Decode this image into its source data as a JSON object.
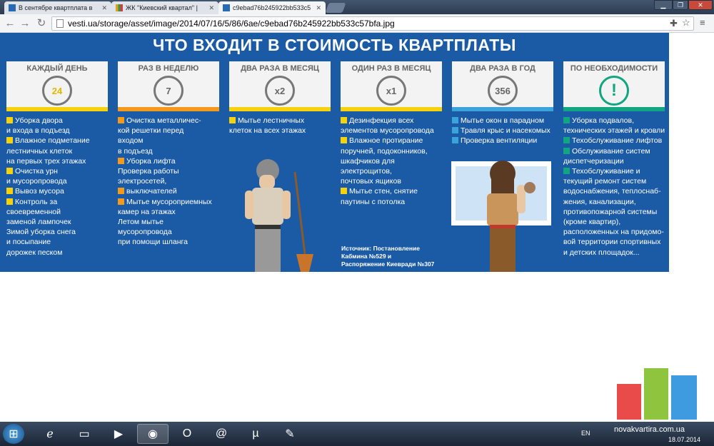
{
  "browser": {
    "tabs": [
      {
        "title": "В сентябре квартплата в",
        "icon": "vesti-favicon",
        "color": "#2a6ab3"
      },
      {
        "title": "ЖК \"Киевский квартал\" |",
        "icon": "chart-favicon",
        "color": "#e0a020"
      },
      {
        "title": "c9ebad76b245922bb533c5",
        "icon": "vesti-favicon",
        "color": "#2a6ab3"
      }
    ],
    "url": "vesti.ua/storage/asset/image/2014/07/16/5/86/6ae/c9ebad76b245922bb533c57bfa.jpg"
  },
  "infographic": {
    "title": "ЧТО ВХОДИТ В СТОИМОСТЬ КВАРТПЛАТЫ",
    "columns": [
      {
        "header": "КАЖДЫЙ ДЕНЬ",
        "icon_text": "24",
        "color": "#f5d20c",
        "items": [
          "Уборка двора",
          "и входа в подъезд",
          "Влажное подметание",
          "лестничных клеток",
          "на первых трех этажах",
          "Очистка урн",
          "и мусоропровода",
          "Вывоз мусора",
          "Контроль за",
          "своевременной",
          "заменой лампочек",
          "Зимой уборка снега",
          "и посыпание",
          "дорожек песком"
        ]
      },
      {
        "header": "РАЗ В НЕДЕЛЮ",
        "icon_text": "7",
        "color": "#f39a1c",
        "items": [
          "Очистка металличес-",
          "кой решетки перед",
          "входом",
          "в подъезд",
          "Уборка лифта",
          "Проверка работы",
          "электросетей,",
          "выключателей",
          "Мытье мусороприемных",
          "камер на этажах",
          "Летом мытье",
          "мусоропровода",
          "при помощи шланга"
        ]
      },
      {
        "header": "ДВА РАЗА В МЕСЯЦ",
        "icon_text": "x2",
        "color": "#f5d20c",
        "items": [
          "Мытье лестничных",
          "клеток на всех этажах"
        ]
      },
      {
        "header": "ОДИН РАЗ В МЕСЯЦ",
        "icon_text": "x1",
        "color": "#f5d20c",
        "items": [
          "Дезинфекция всех",
          "элементов мусоропровода",
          "Влажное протирание",
          "поручней, подоконников,",
          "шкафчиков для",
          "электрощитов,",
          "почтовых ящиков",
          "Мытье стен, снятие",
          "паутины с потолка"
        ]
      },
      {
        "header": "ДВА РАЗА В ГОД",
        "icon_text": "356",
        "color": "#3aa3dc",
        "items": [
          "Мытье окон в парадном",
          "Травля крыс и насекомых",
          "Проверка вентиляции"
        ]
      },
      {
        "header": "ПО НЕОБХОДИМОСТИ",
        "icon_text": "!",
        "color": "#12a582",
        "items": [
          "Уборка подвалов,",
          "технических этажей и кровли",
          "Техобслуживание лифтов",
          "Обслуживание систем",
          "диспетчеризации",
          "Техобслуживание и",
          "текущий ремонт систем",
          "водоснабжения, теплоснаб-",
          "жения, канализации,",
          "противопожарной системы",
          "(кроме квартир),",
          "расположенных на придомо-",
          "вой территории спортивных",
          "и детских площадок..."
        ]
      }
    ],
    "bullets": [
      [
        0,
        2,
        5,
        7,
        8
      ],
      [
        0,
        4,
        7,
        8
      ],
      [
        0
      ],
      [
        0,
        2,
        7
      ],
      [
        0,
        1,
        2
      ],
      [
        0,
        2,
        3,
        5
      ]
    ],
    "source": [
      "Источник: Постановление",
      "Кабмина №529 и",
      "Распоряжение Киевради №307"
    ]
  },
  "watermark": "novakvartira.com.ua",
  "taskbar": {
    "lang": "EN",
    "date": "18.07.2014"
  }
}
